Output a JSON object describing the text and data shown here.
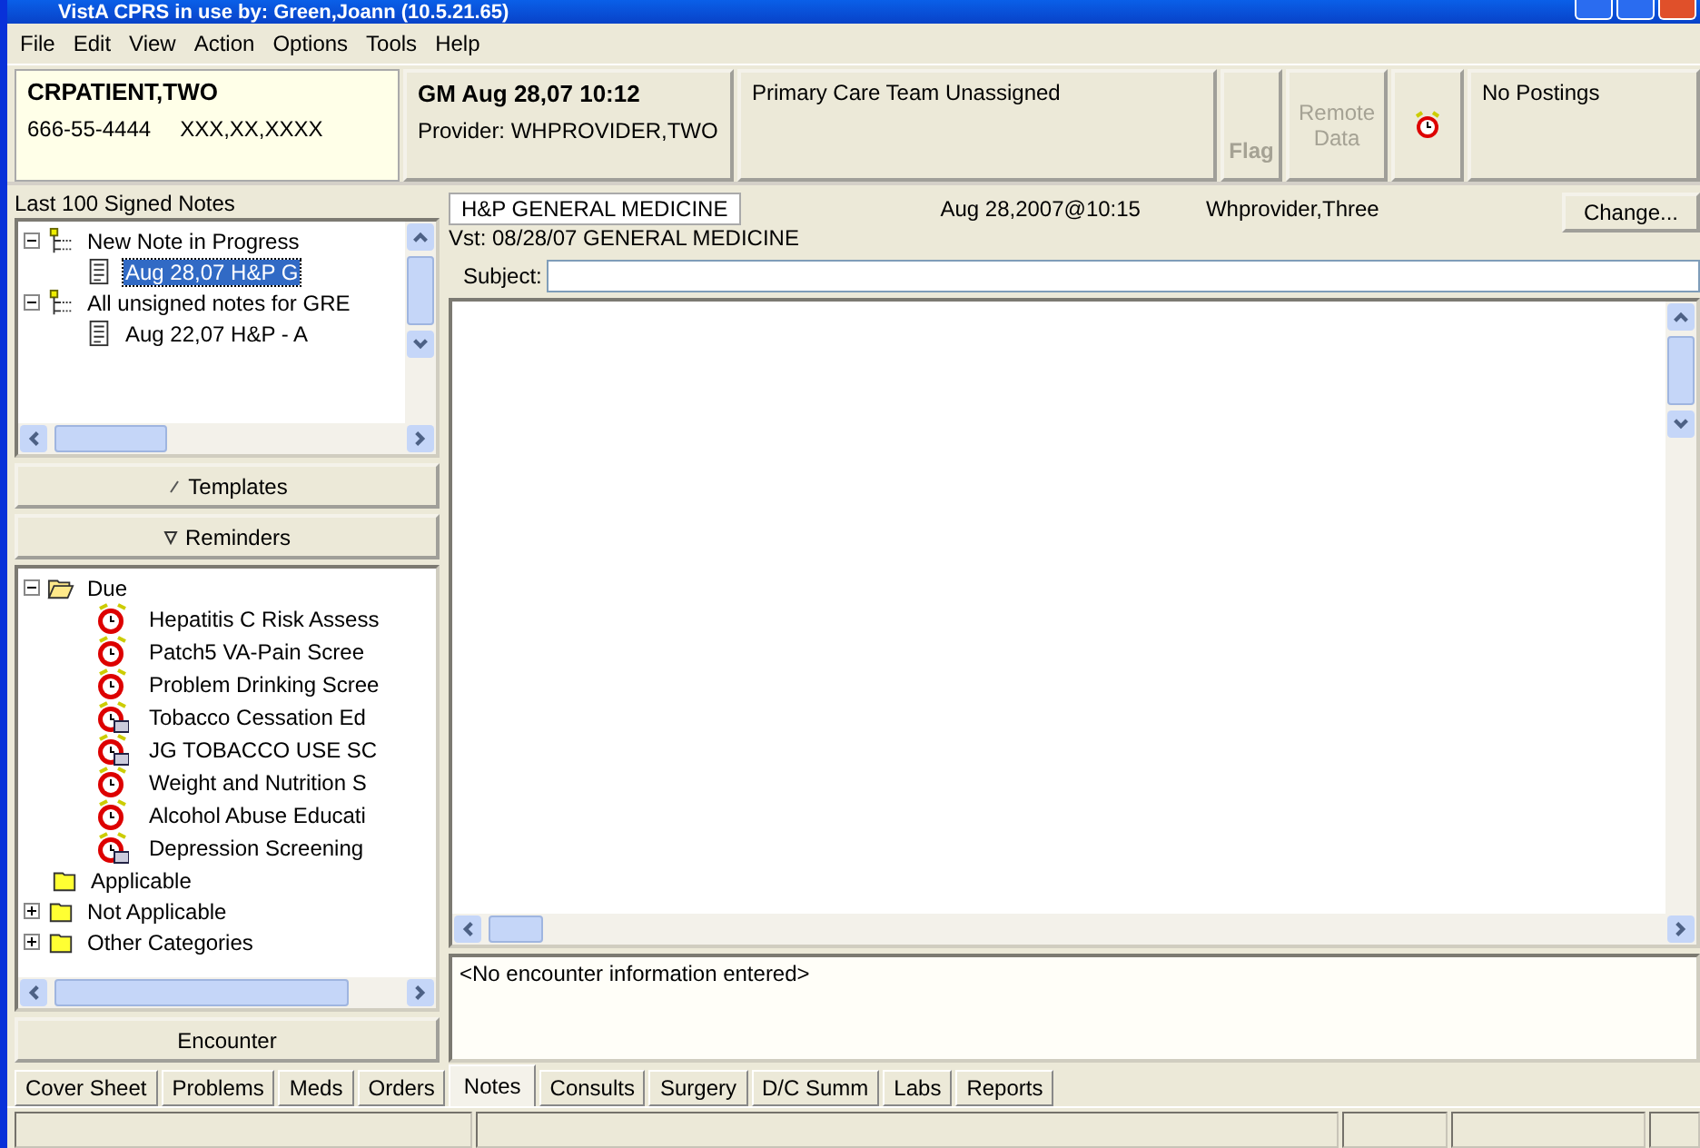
{
  "window": {
    "title": "VistA CPRS in use by: Green,Joann  (10.5.21.65)"
  },
  "menu": [
    "File",
    "Edit",
    "View",
    "Action",
    "Options",
    "Tools",
    "Help"
  ],
  "patient": {
    "name": "CRPATIENT,TWO",
    "ssn": "666-55-4444",
    "dob": "XXX,XX,XXXX"
  },
  "visit": {
    "location_time": "GM Aug 28,07 10:12",
    "provider": "Provider:  WHPROVIDER,TWO"
  },
  "primary_care": "Primary Care Team Unassigned",
  "header_buttons": [
    {
      "label": "Flag",
      "kind": "flag",
      "disabled": true
    },
    {
      "label": "Remote Data",
      "kind": "remote",
      "disabled": true
    }
  ],
  "postings": "No Postings",
  "notes_tree": {
    "label": "Last 100 Signed Notes",
    "items": [
      {
        "label": "New Note in Progress",
        "expanded": true,
        "children": [
          {
            "label": "Aug 28,07  H&P G",
            "selected": true
          }
        ]
      },
      {
        "label": "All unsigned notes for GRE",
        "expanded": true,
        "children": [
          {
            "label": "Aug 22,07  H&P - A",
            "selected": false
          }
        ]
      }
    ]
  },
  "side_buttons": [
    {
      "label": "Templates",
      "kind": "templates"
    },
    {
      "label": "Reminders",
      "kind": "reminders"
    }
  ],
  "reminders_tree": [
    {
      "label": "Due",
      "expanded": true,
      "children": [
        {
          "label": "Hepatitis C Risk Assess",
          "kind": "clock"
        },
        {
          "label": "Patch5 VA-Pain Scree",
          "kind": "clock"
        },
        {
          "label": "Problem Drinking Scree",
          "kind": "clock"
        },
        {
          "label": "Tobacco Cessation Ed",
          "kind": "clock-note"
        },
        {
          "label": "JG TOBACCO USE SC",
          "kind": "clock-note"
        },
        {
          "label": "Weight and Nutrition S",
          "kind": "clock"
        },
        {
          "label": "Alcohol Abuse Educati",
          "kind": "clock"
        },
        {
          "label": "Depression Screening",
          "kind": "clock-note"
        }
      ]
    },
    {
      "label": "Applicable"
    },
    {
      "label": "Not Applicable",
      "expanded": false
    },
    {
      "label": "Other Categories",
      "expanded": false
    }
  ],
  "encounter_button": "Encounter",
  "note": {
    "title": "H&P GENERAL MEDICINE",
    "date": "Aug 28,2007@10:15",
    "author": "Whprovider,Three",
    "change_button": "Change...",
    "visit": "Vst: 08/28/07  GENERAL MEDICINE",
    "subject_label": "Subject:"
  },
  "encounter_info": "<No encounter information entered>",
  "tabs": [
    {
      "label": "Cover Sheet",
      "selected": false
    },
    {
      "label": "Problems",
      "selected": false
    },
    {
      "label": "Meds",
      "selected": false
    },
    {
      "label": "Orders",
      "selected": false
    },
    {
      "label": "Notes",
      "selected": true
    },
    {
      "label": "Consults",
      "selected": false
    },
    {
      "label": "Surgery",
      "selected": false
    },
    {
      "label": "D/C Summ",
      "selected": false
    },
    {
      "label": "Labs",
      "selected": false
    },
    {
      "label": "Reports",
      "selected": false
    }
  ]
}
